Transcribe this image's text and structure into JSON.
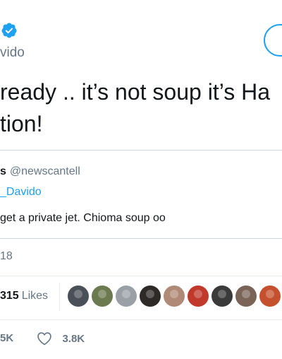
{
  "header": {
    "verified_icon": "verified-badge-icon",
    "handle": "vido"
  },
  "tweet": {
    "line1": "ready .. it’s not soup it’s Ha",
    "line2": "tion!"
  },
  "quote": {
    "name": "s",
    "handle": "@newscantell",
    "reply_to": "_Davido",
    "text": "get a private jet. Chioma soup oo"
  },
  "timestamp": "18",
  "stats": {
    "likes_count": "315",
    "likes_label": "Likes",
    "avatars": [
      {
        "name": "liker-avatar",
        "color": "#4a5058"
      },
      {
        "name": "liker-avatar",
        "color": "#6b7a4f"
      },
      {
        "name": "liker-avatar",
        "color": "#9aa0a6"
      },
      {
        "name": "liker-avatar",
        "color": "#2d2a28"
      },
      {
        "name": "liker-avatar",
        "color": "#b08a76"
      },
      {
        "name": "liker-avatar",
        "color": "#c0392b"
      },
      {
        "name": "liker-avatar",
        "color": "#3a3a3a"
      },
      {
        "name": "liker-avatar",
        "color": "#7a6458"
      },
      {
        "name": "liker-avatar",
        "color": "#c4502e"
      },
      {
        "name": "liker-avatar",
        "color": "#55504b"
      }
    ]
  },
  "actions": {
    "retweets": "5K",
    "heart_icon": "heart-icon",
    "likes": "3.8K"
  },
  "colors": {
    "accent": "#1da1f2",
    "muted": "#657786",
    "text": "#14171a",
    "border": "#e6ecf0"
  }
}
